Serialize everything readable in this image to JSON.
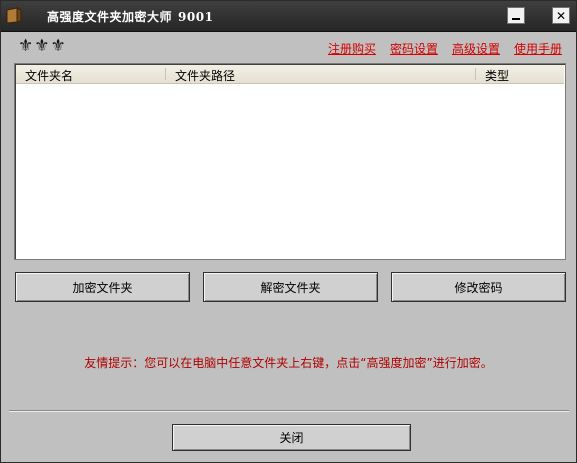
{
  "window": {
    "title": "高强度文件夹加密大师",
    "version": "9001"
  },
  "icons": {
    "app": "folder-lock-icon",
    "minimize": "minimize-icon",
    "close": "close-icon",
    "decor": "fleur-de-lis-icon"
  },
  "top_links": {
    "register": "注册购买",
    "password_settings": "密码设置",
    "advanced_settings": "高级设置",
    "manual": "使用手册"
  },
  "list": {
    "columns": [
      "文件夹名",
      "文件夹路径",
      "类型"
    ],
    "rows": []
  },
  "buttons": {
    "encrypt": "加密文件夹",
    "decrypt": "解密文件夹",
    "change_password": "修改密码",
    "close": "关闭"
  },
  "tip": "友情提示：您可以在电脑中任意文件夹上右键，点击“高强度加密”进行加密。",
  "colors": {
    "link": "#d40000",
    "tip": "#b00000",
    "titlebar": "#2f2f2f"
  }
}
